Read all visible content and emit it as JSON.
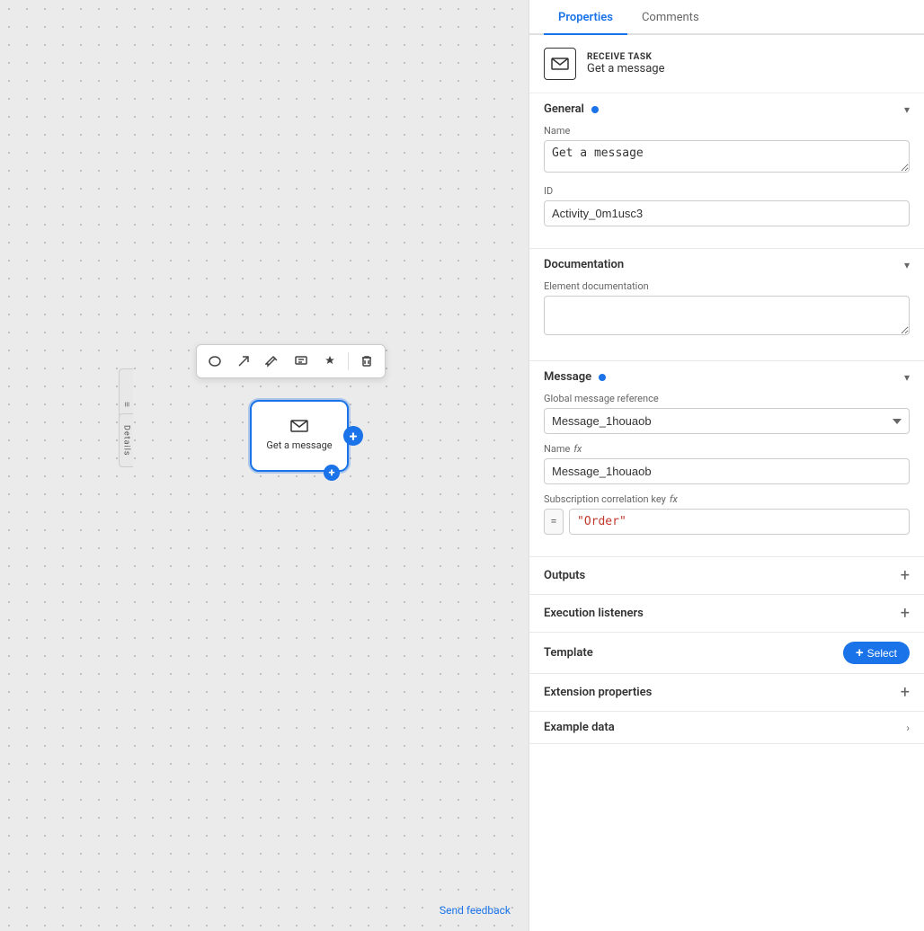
{
  "tabs": {
    "properties": "Properties",
    "comments": "Comments",
    "active": "properties"
  },
  "task_header": {
    "type": "RECEIVE TASK",
    "name": "Get a message"
  },
  "sections": {
    "general": {
      "title": "General",
      "has_dot": true,
      "fields": {
        "name_label": "Name",
        "name_value": "Get a message",
        "id_label": "ID",
        "id_value": "Activity_0m1usc3"
      }
    },
    "documentation": {
      "title": "Documentation",
      "doc_label": "Element documentation",
      "doc_value": ""
    },
    "message": {
      "title": "Message",
      "has_dot": true,
      "global_ref_label": "Global message reference",
      "global_ref_value": "Message_1houaob",
      "name_label": "Name",
      "name_fx": "fx",
      "name_value": "Message_1houaob",
      "correlation_label": "Subscription correlation key",
      "correlation_fx": "fx",
      "correlation_eq": "=",
      "correlation_value": "\"Order\""
    },
    "outputs": {
      "title": "Outputs"
    },
    "execution_listeners": {
      "title": "Execution listeners"
    },
    "template": {
      "title": "Template",
      "select_btn": "+ Select"
    },
    "extension_properties": {
      "title": "Extension properties"
    },
    "example_data": {
      "title": "Example data"
    }
  },
  "canvas": {
    "node_label": "Get a\nmessage",
    "send_feedback": "Send feedback",
    "details_label": "Details"
  },
  "toolbar": {
    "tools": [
      "○",
      "↗",
      "✏",
      "□",
      "✦",
      "🗑"
    ]
  }
}
